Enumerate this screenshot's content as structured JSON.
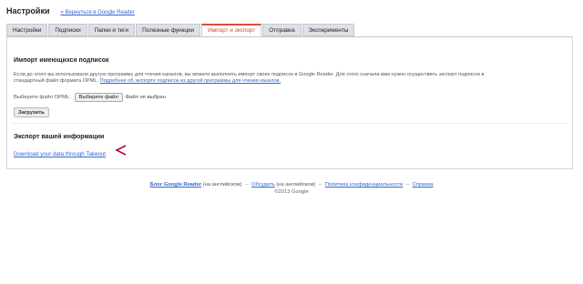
{
  "header": {
    "title": "Настройки",
    "back_link": "« Вернуться в Google Reader"
  },
  "tabs": [
    {
      "label": "Настройки"
    },
    {
      "label": "Подписки"
    },
    {
      "label": "Папки и теги"
    },
    {
      "label": "Полезные функции"
    },
    {
      "label": "Импорт и экспорт",
      "active": true
    },
    {
      "label": "Отправка"
    },
    {
      "label": "Эксперименты"
    }
  ],
  "import": {
    "title": "Импорт имеющихся подписок",
    "description_line1": "Если до этого вы использовали другую программу для чтения каналов, вы можете выполнить импорт своих подписок в Google Reader. Для этого сначала вам нужно осуществить экспорт подписок в",
    "description_line2_start": "стандартный файл формата OPML.",
    "description_link": "Подробнее об экспорте подписок из другой программы для чтения каналов.",
    "file_label": "Выберите файл OPML:",
    "file_button": "Выберите файл",
    "file_status": "Файл не выбран",
    "upload_button": "Загрузить"
  },
  "export": {
    "title": "Экспорт вашей информации",
    "takeout_link": "Download your data through Takeout"
  },
  "footer": {
    "blog_link": "Блог Google Reader",
    "blog_note": "(на английском)",
    "sep": "–",
    "discuss_link": "Обсудить",
    "discuss_note": "(на английском)",
    "privacy_link": "Политика конфиденциальности",
    "help_link": "Справка",
    "copyright": "©2013 Google"
  },
  "colors": {
    "accent_tab": "#dd4b39",
    "link": "#3366cc",
    "arrow": "#b3003c"
  }
}
